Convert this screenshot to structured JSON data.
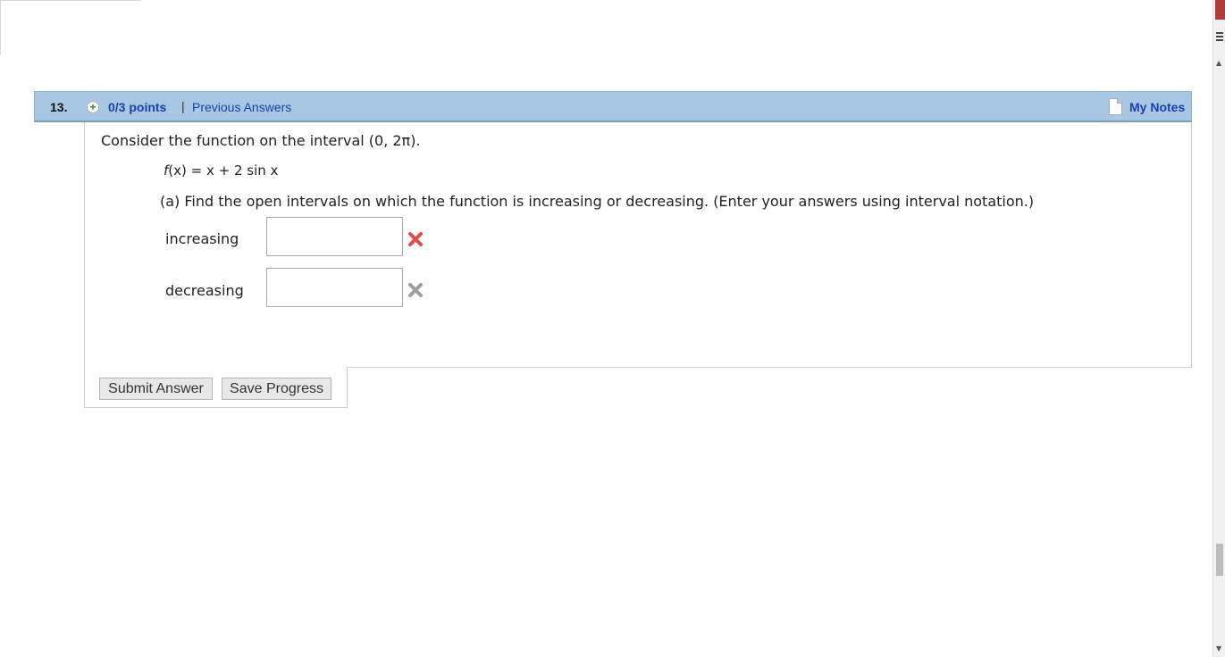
{
  "question": {
    "number": "13.",
    "points": "0/3 points",
    "separator": "|",
    "previous_answers": "Previous Answers",
    "my_notes": "My Notes"
  },
  "content": {
    "intro": "Consider the function on the interval  (0, 2π).",
    "function_lhs": "f",
    "function_rest": "(x) = x + 2 sin x",
    "part_a": "(a) Find the open intervals on which the function is increasing or decreasing. (Enter your answers using interval notation.)",
    "increasing_label": "increasing",
    "decreasing_label": "decreasing",
    "increasing_value": "",
    "decreasing_value": ""
  },
  "buttons": {
    "submit": "Submit Answer",
    "save": "Save Progress"
  },
  "colors": {
    "header_bg": "#a7c7e3",
    "link": "#1a3fb0",
    "incorrect_mark": "#e84a4a",
    "neutral_mark": "#9e9e9e"
  }
}
